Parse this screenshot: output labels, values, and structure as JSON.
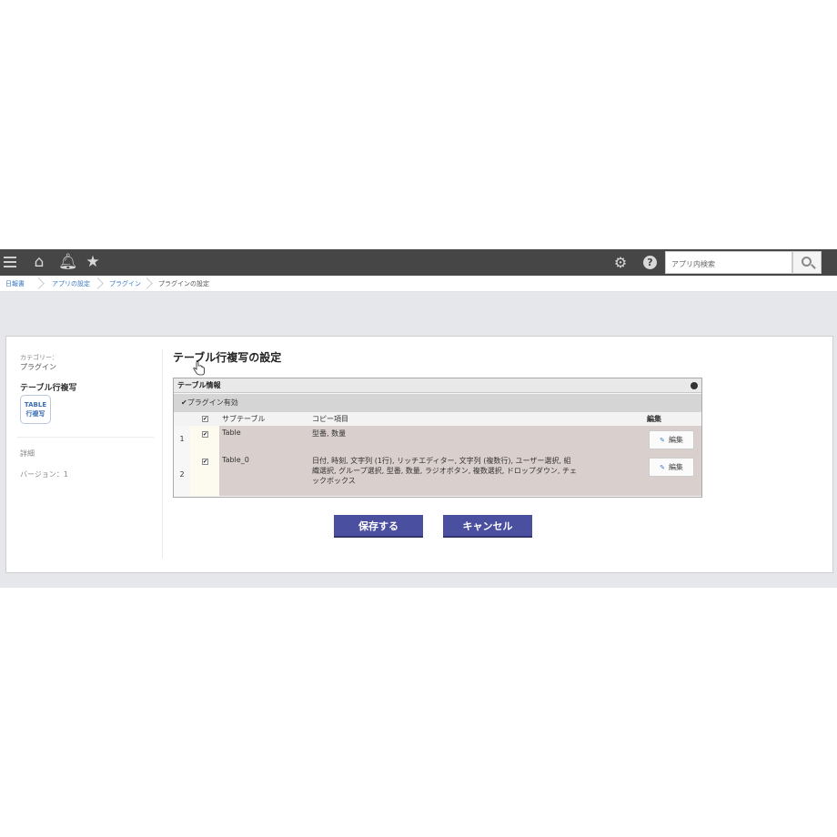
{
  "topbar": {
    "search_placeholder": "アプリ内検索"
  },
  "icons": {
    "menu": "hamburger-icon",
    "home": "home-icon",
    "bell": "bell-icon",
    "star": "star-icon",
    "gear": "gear-icon",
    "help": "help-icon",
    "search": "search-icon"
  },
  "breadcrumb": [
    "日報書",
    "アプリの設定",
    "プラグイン",
    "プラグインの設定"
  ],
  "sidebar": {
    "category_label": "カテゴリー：",
    "category_value": "プラグイン",
    "plugin_name": "テーブル行複写",
    "logo_line1": "TABLE",
    "logo_line2": "行複写",
    "detail_link": "詳細",
    "version": "バージョン：1"
  },
  "main": {
    "title": "テーブル行複写の設定",
    "section_title": "テーブル情報",
    "enable_label": "✔プラグイン有効",
    "columns": [
      "サブテーブル",
      "コピー項目",
      "編集"
    ],
    "rows": [
      {
        "num": "1",
        "checked": "✔",
        "subtable": "Table",
        "items": "型番, 数量",
        "edit": "編集"
      },
      {
        "num": "2",
        "checked": "✔",
        "subtable": "Table_0",
        "items_line1": "日付, 時刻, 文字列 (1行), リッチエディター, 文字列 (複数行), ユーザー選択, 組",
        "items_line2": "織選択, グループ選択, 型番, 数量, ラジオボタン, 複数選択, ドロップダウン, チェ",
        "items_line3": "ックボックス",
        "edit": "編集"
      }
    ],
    "save_label": "保存する",
    "cancel_label": "キャンセル"
  },
  "colors": {
    "topbar": "#464646",
    "row_highlight": "#d9cfcd",
    "primary_button": "#4a4fa0",
    "link": "#3a78c3"
  }
}
